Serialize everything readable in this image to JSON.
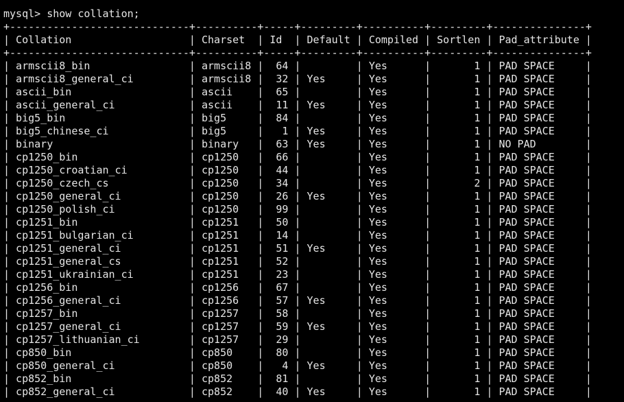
{
  "prompt_line": "mysql> show collation;",
  "separator": "+-----------------------------+----------+-----+---------+----------+---------+---------------+",
  "header": [
    "Collation",
    "Charset",
    "Id",
    "Default",
    "Compiled",
    "Sortlen",
    "Pad_attribute"
  ],
  "rows": [
    [
      "armscii8_bin",
      "armscii8",
      "64",
      "",
      "Yes",
      "1",
      "PAD SPACE"
    ],
    [
      "armscii8_general_ci",
      "armscii8",
      "32",
      "Yes",
      "Yes",
      "1",
      "PAD SPACE"
    ],
    [
      "ascii_bin",
      "ascii",
      "65",
      "",
      "Yes",
      "1",
      "PAD SPACE"
    ],
    [
      "ascii_general_ci",
      "ascii",
      "11",
      "Yes",
      "Yes",
      "1",
      "PAD SPACE"
    ],
    [
      "big5_bin",
      "big5",
      "84",
      "",
      "Yes",
      "1",
      "PAD SPACE"
    ],
    [
      "big5_chinese_ci",
      "big5",
      "1",
      "Yes",
      "Yes",
      "1",
      "PAD SPACE"
    ],
    [
      "binary",
      "binary",
      "63",
      "Yes",
      "Yes",
      "1",
      "NO PAD"
    ],
    [
      "cp1250_bin",
      "cp1250",
      "66",
      "",
      "Yes",
      "1",
      "PAD SPACE"
    ],
    [
      "cp1250_croatian_ci",
      "cp1250",
      "44",
      "",
      "Yes",
      "1",
      "PAD SPACE"
    ],
    [
      "cp1250_czech_cs",
      "cp1250",
      "34",
      "",
      "Yes",
      "2",
      "PAD SPACE"
    ],
    [
      "cp1250_general_ci",
      "cp1250",
      "26",
      "Yes",
      "Yes",
      "1",
      "PAD SPACE"
    ],
    [
      "cp1250_polish_ci",
      "cp1250",
      "99",
      "",
      "Yes",
      "1",
      "PAD SPACE"
    ],
    [
      "cp1251_bin",
      "cp1251",
      "50",
      "",
      "Yes",
      "1",
      "PAD SPACE"
    ],
    [
      "cp1251_bulgarian_ci",
      "cp1251",
      "14",
      "",
      "Yes",
      "1",
      "PAD SPACE"
    ],
    [
      "cp1251_general_ci",
      "cp1251",
      "51",
      "Yes",
      "Yes",
      "1",
      "PAD SPACE"
    ],
    [
      "cp1251_general_cs",
      "cp1251",
      "52",
      "",
      "Yes",
      "1",
      "PAD SPACE"
    ],
    [
      "cp1251_ukrainian_ci",
      "cp1251",
      "23",
      "",
      "Yes",
      "1",
      "PAD SPACE"
    ],
    [
      "cp1256_bin",
      "cp1256",
      "67",
      "",
      "Yes",
      "1",
      "PAD SPACE"
    ],
    [
      "cp1256_general_ci",
      "cp1256",
      "57",
      "Yes",
      "Yes",
      "1",
      "PAD SPACE"
    ],
    [
      "cp1257_bin",
      "cp1257",
      "58",
      "",
      "Yes",
      "1",
      "PAD SPACE"
    ],
    [
      "cp1257_general_ci",
      "cp1257",
      "59",
      "Yes",
      "Yes",
      "1",
      "PAD SPACE"
    ],
    [
      "cp1257_lithuanian_ci",
      "cp1257",
      "29",
      "",
      "Yes",
      "1",
      "PAD SPACE"
    ],
    [
      "cp850_bin",
      "cp850",
      "80",
      "",
      "Yes",
      "1",
      "PAD SPACE"
    ],
    [
      "cp850_general_ci",
      "cp850",
      "4",
      "Yes",
      "Yes",
      "1",
      "PAD SPACE"
    ],
    [
      "cp852_bin",
      "cp852",
      "81",
      "",
      "Yes",
      "1",
      "PAD SPACE"
    ],
    [
      "cp852_general_ci",
      "cp852",
      "40",
      "Yes",
      "Yes",
      "1",
      "PAD SPACE"
    ]
  ]
}
